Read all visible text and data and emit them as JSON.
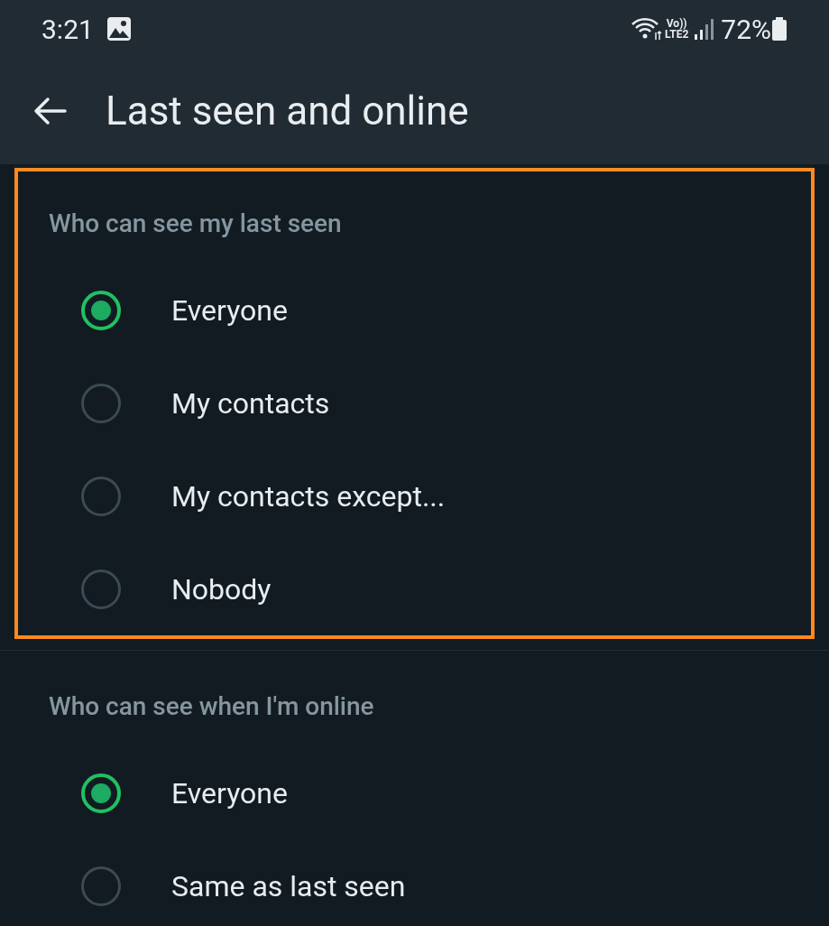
{
  "status_bar": {
    "time": "3:21",
    "volte": "Vo))",
    "network": "LTE2",
    "battery": "72%"
  },
  "header": {
    "title": "Last seen and online"
  },
  "sections": [
    {
      "title": "Who can see my last seen",
      "highlighted": true,
      "options": [
        {
          "label": "Everyone",
          "selected": true
        },
        {
          "label": "My contacts",
          "selected": false
        },
        {
          "label": "My contacts except...",
          "selected": false
        },
        {
          "label": "Nobody",
          "selected": false
        }
      ]
    },
    {
      "title": "Who can see when I'm online",
      "highlighted": false,
      "options": [
        {
          "label": "Everyone",
          "selected": true
        },
        {
          "label": "Same as last seen",
          "selected": false
        }
      ]
    }
  ]
}
